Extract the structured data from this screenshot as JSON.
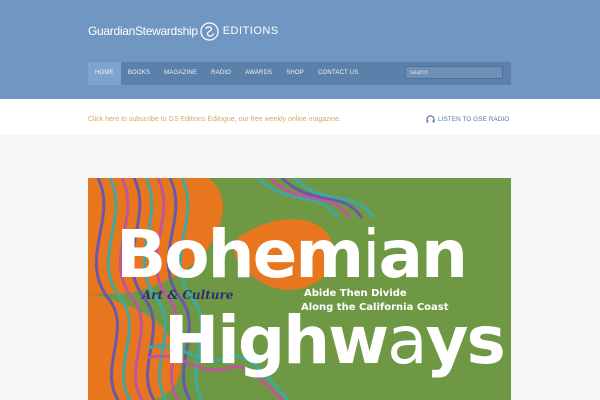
{
  "brand": {
    "name_part1": "Guardian",
    "name_part2": "Stewardship",
    "editions": "EDITIONS"
  },
  "nav": {
    "items": [
      {
        "label": "HOME"
      },
      {
        "label": "BOOKS"
      },
      {
        "label": "MAGAZINE"
      },
      {
        "label": "RADIO"
      },
      {
        "label": "AWARDS"
      },
      {
        "label": "SHOP"
      },
      {
        "label": "CONTACT US"
      }
    ],
    "search_placeholder": "search"
  },
  "subbar": {
    "subscribe_text": "Click here to subscribe to GS Editions Edilogue, our free weekly online magazine.",
    "radio_label": "LISTEN TO GSE RADIO"
  },
  "banner": {
    "title_line1_a": "Bohem",
    "title_line1_b": "i",
    "title_line1_c": "an",
    "title_line2_a": "High",
    "title_line2_b": "w",
    "title_line2_c": "a",
    "title_line2_d": "ys",
    "tagline_part1": "Art & Culture",
    "tagline_part2": "Abide Then Divide",
    "tagline_line2": "Along the California Coast"
  },
  "colors": {
    "header": "#6f97c2",
    "nav": "#5b80a9",
    "banner_green": "#6f9845",
    "banner_orange": "#e8761f",
    "subscribe_link": "#d7a765"
  }
}
